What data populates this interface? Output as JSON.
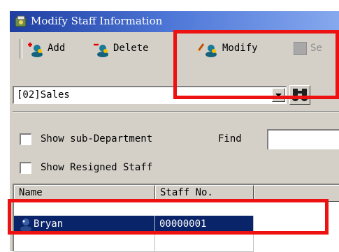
{
  "window": {
    "title": "Modify Staff Information"
  },
  "toolbar": {
    "add_label": "Add",
    "delete_label": "Delete",
    "modify_label": "Modify",
    "next_label": "Se"
  },
  "department": {
    "selected": "[02]Sales"
  },
  "options": {
    "show_sub_department": {
      "label": "Show sub-Department",
      "checked": false
    },
    "show_resigned": {
      "label": "Show Resigned Staff",
      "checked": false
    },
    "find_label": "Find",
    "find_value": ""
  },
  "grid": {
    "columns": [
      "Name",
      "Staff No."
    ],
    "rows": [
      {
        "name": "Bryan",
        "staff_no": "00000001",
        "selected": true
      }
    ]
  },
  "colors": {
    "highlight": "#ee1111",
    "selection": "#0a246a",
    "titlebar": "#1e3ea0",
    "face": "#d4d0c8"
  },
  "icons": {
    "title": "staff-app-icon",
    "add": "add-person-icon",
    "delete": "delete-person-icon",
    "modify": "edit-person-icon",
    "find": "binoculars-icon",
    "row": "person-icon"
  }
}
